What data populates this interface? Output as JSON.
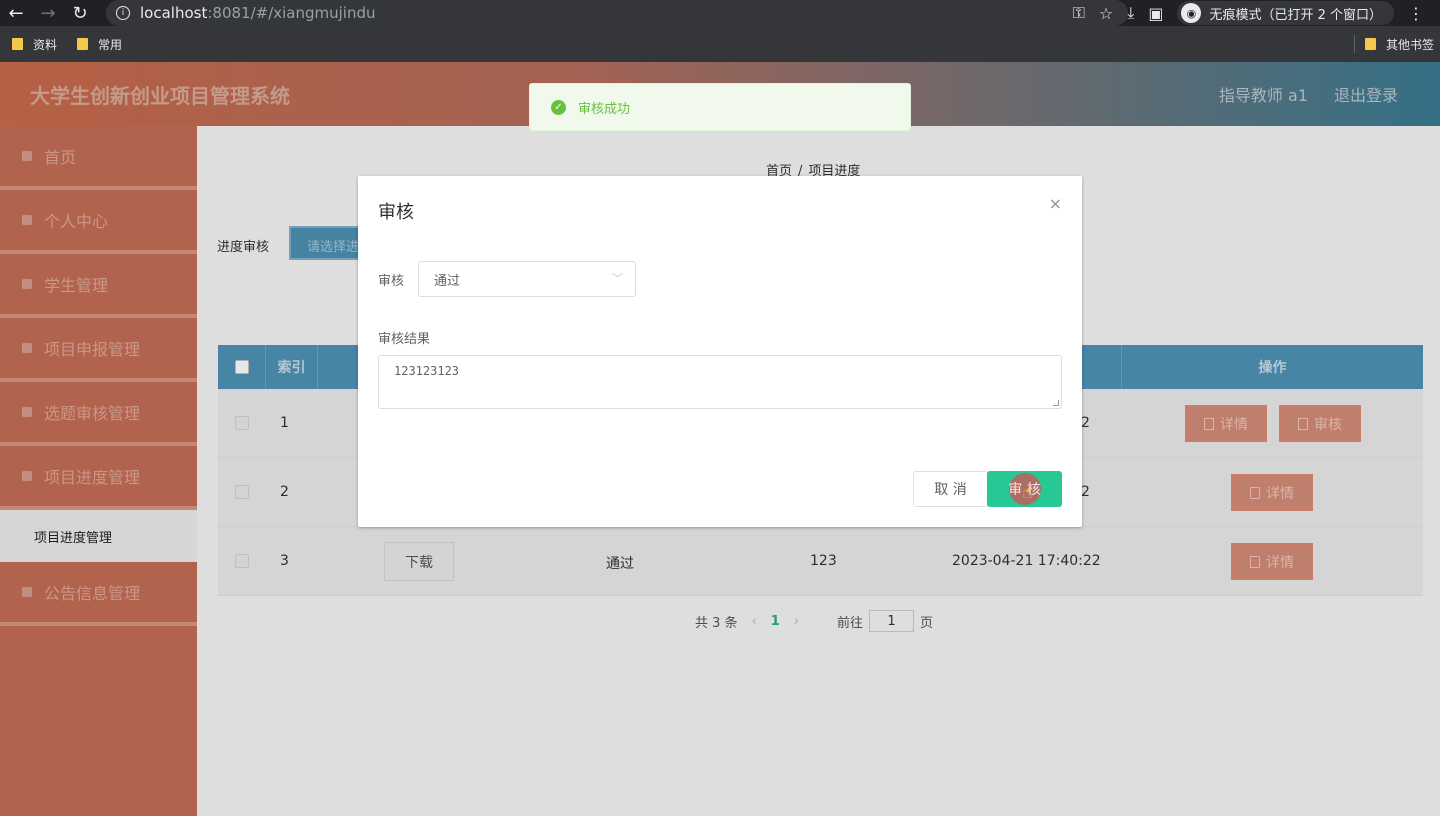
{
  "browser": {
    "url_host": "localhost",
    "url_rest": ":8081/#/xiangmujindu",
    "incognito_label": "无痕模式（已打开 2 个窗口）",
    "bookmarks": [
      "资料",
      "常用"
    ],
    "other_bookmarks": "其他书签"
  },
  "header": {
    "title": "大学生创新创业项目管理系统",
    "user": "指导教师 a1",
    "logout": "退出登录"
  },
  "sidebar": {
    "items": [
      {
        "label": "首页"
      },
      {
        "label": "个人中心"
      },
      {
        "label": "学生管理"
      },
      {
        "label": "项目申报管理"
      },
      {
        "label": "选题审核管理"
      },
      {
        "label": "项目进度管理"
      }
    ],
    "submenu_label": "项目进度管理",
    "last_item": "公告信息管理"
  },
  "breadcrumb": {
    "home": "首页",
    "sep": "/",
    "current": "项目进度"
  },
  "filter": {
    "label": "进度审核",
    "placeholder": "请选择进"
  },
  "table": {
    "headers": {
      "index": "索引",
      "operation": "操作"
    },
    "rows": [
      {
        "index": "1",
        "tail": "2",
        "detail": "详情",
        "audit": "审核"
      },
      {
        "index": "2",
        "tail": "2",
        "detail": "详情"
      },
      {
        "index": "3",
        "download": "下载",
        "status": "通过",
        "num": "123",
        "time": "2023-04-21 17:40:22",
        "detail": "详情"
      }
    ]
  },
  "pager": {
    "total": "共 3 条",
    "prev": "‹",
    "current": "1",
    "next": "›",
    "goto": "前往",
    "page_value": "1",
    "page_suffix": "页"
  },
  "toast": {
    "message": "审核成功",
    "color": "#67c23a"
  },
  "dialog": {
    "title": "审核",
    "close": "×",
    "field1_label": "审核",
    "field1_value": "通过",
    "field2_label": "审核结果",
    "field2_value": "123123123",
    "cancel": "取 消",
    "confirm": "审 核"
  }
}
